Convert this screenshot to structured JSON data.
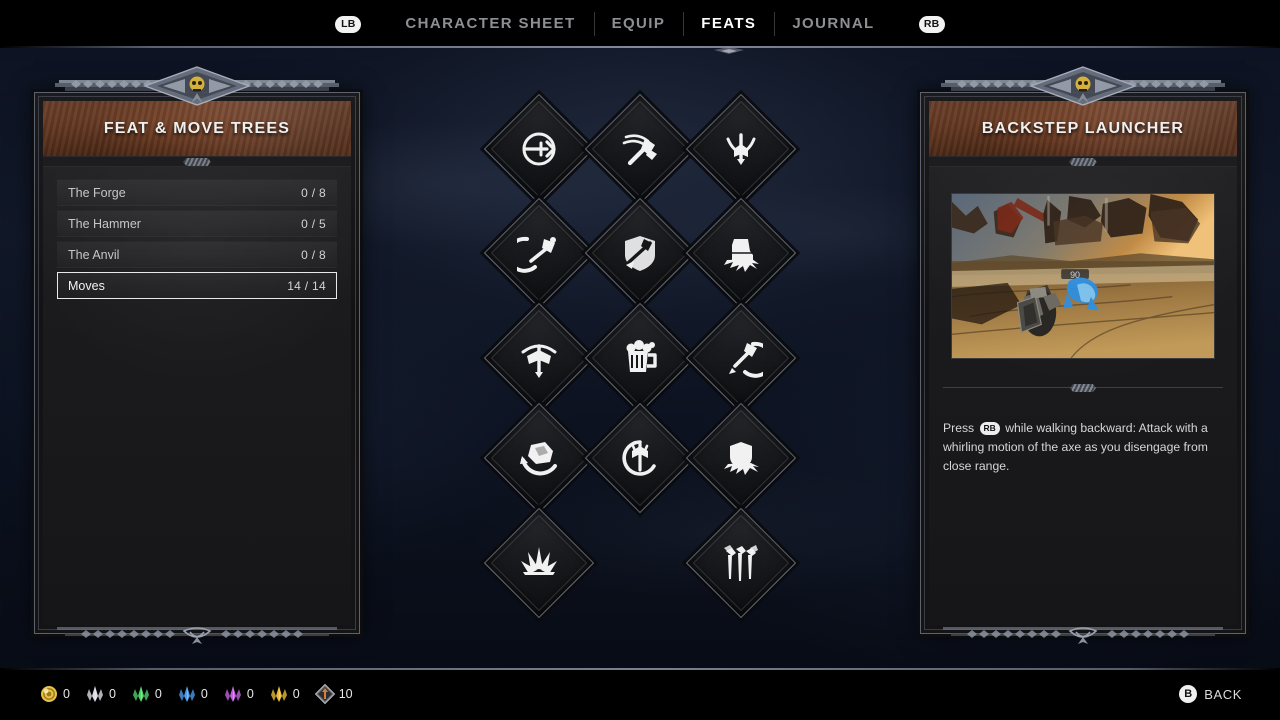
{
  "topbar": {
    "left_bumper": "LB",
    "right_bumper": "RB",
    "tabs": [
      {
        "label": "CHARACTER SHEET",
        "active": false
      },
      {
        "label": "EQUIP",
        "active": false
      },
      {
        "label": "FEATS",
        "active": true
      },
      {
        "label": "JOURNAL",
        "active": false
      }
    ]
  },
  "left_panel": {
    "title": "FEAT & MOVE TREES",
    "rows": [
      {
        "name": "The Forge",
        "count": "0 / 8",
        "selected": false
      },
      {
        "name": "The Hammer",
        "count": "0 / 5",
        "selected": false
      },
      {
        "name": "The Anvil",
        "count": "0 / 8",
        "selected": false
      },
      {
        "name": "Moves",
        "count": "14 / 14",
        "selected": true
      }
    ]
  },
  "right_panel": {
    "title": "Backstep Launcher",
    "screenshot_alt": "gameplay preview: dwarf with shield facing a glowing blue enemy on sandy ruins",
    "description_prefix": "Press",
    "description_button": "RB",
    "description_suffix": "while walking backward: Attack with a whirling motion of the axe as you disengage from close range."
  },
  "skill_tree": {
    "nodes": [
      {
        "id": "n1",
        "icon": "target-pull-icon",
        "col": 0,
        "row": 0
      },
      {
        "id": "n2",
        "icon": "overhead-axe-icon",
        "col": 1,
        "row": 0
      },
      {
        "id": "n3",
        "icon": "axe-throw-icon",
        "col": 2,
        "row": 0
      },
      {
        "id": "n4",
        "icon": "axe-swing-icon",
        "col": 0,
        "row": 1
      },
      {
        "id": "n5",
        "icon": "shield-axe-icon",
        "col": 1,
        "row": 1
      },
      {
        "id": "n6",
        "icon": "boot-stomp-icon",
        "col": 2,
        "row": 1
      },
      {
        "id": "n7",
        "icon": "double-axe-icon",
        "col": 0,
        "row": 2
      },
      {
        "id": "n8",
        "icon": "beer-mug-icon",
        "col": 1,
        "row": 2
      },
      {
        "id": "n9",
        "icon": "axe-uppercut-icon",
        "col": 2,
        "row": 2
      },
      {
        "id": "n10",
        "icon": "boulder-throw-icon",
        "col": 0,
        "row": 3
      },
      {
        "id": "n11",
        "icon": "axe-spin-icon",
        "col": 1,
        "row": 3
      },
      {
        "id": "n12",
        "icon": "shield-bash-icon",
        "col": 2,
        "row": 3
      },
      {
        "id": "n13",
        "icon": "ground-slam-icon",
        "col": 0,
        "row": 4
      },
      {
        "id": "n14",
        "icon": "axe-volley-icon",
        "col": 2,
        "row": 4
      }
    ],
    "links": [
      {
        "type": "v",
        "col": 0,
        "from_row": 0,
        "to_row": 1
      },
      {
        "type": "v",
        "col": 1,
        "from_row": 0,
        "to_row": 1
      },
      {
        "type": "v",
        "col": 2,
        "from_row": 0,
        "to_row": 1
      },
      {
        "type": "h",
        "row": 1,
        "from_col": 0,
        "to_col": 1
      },
      {
        "type": "h",
        "row": 1,
        "from_col": 1,
        "to_col": 2
      },
      {
        "type": "v",
        "col": 0,
        "from_row": 1,
        "to_row": 2
      },
      {
        "type": "v",
        "col": 2,
        "from_row": 1,
        "to_row": 2
      },
      {
        "type": "h",
        "row": 2,
        "from_col": 0,
        "to_col": 1
      },
      {
        "type": "h",
        "row": 2,
        "from_col": 1,
        "to_col": 2
      },
      {
        "type": "v",
        "col": 0,
        "from_row": 2,
        "to_row": 3
      },
      {
        "type": "v",
        "col": 1,
        "from_row": 2,
        "to_row": 3
      },
      {
        "type": "v",
        "col": 2,
        "from_row": 2,
        "to_row": 3
      },
      {
        "type": "h",
        "row": 3,
        "from_col": 0,
        "to_col": 1
      },
      {
        "type": "h",
        "row": 3,
        "from_col": 1,
        "to_col": 2
      },
      {
        "type": "v",
        "col": 0,
        "from_row": 3,
        "to_row": 4
      },
      {
        "type": "v",
        "col": 2,
        "from_row": 3,
        "to_row": 4
      }
    ]
  },
  "bottombar": {
    "currencies": [
      {
        "icon": "gold-coin-icon",
        "color": "#e8c14a",
        "value": "0"
      },
      {
        "icon": "white-crystal-icon",
        "color": "#dcdde2",
        "value": "0"
      },
      {
        "icon": "green-crystal-icon",
        "color": "#4fd06a",
        "value": "0"
      },
      {
        "icon": "blue-crystal-icon",
        "color": "#4a9ae8",
        "value": "0"
      },
      {
        "icon": "purple-crystal-icon",
        "color": "#c261de",
        "value": "0"
      },
      {
        "icon": "yellow-crystal-icon",
        "color": "#e8bb3a",
        "value": "0"
      },
      {
        "icon": "skill-point-icon",
        "color": "#d4803c",
        "value": "10"
      }
    ],
    "back_button_glyph": "B",
    "back_button_label": "BACK"
  }
}
